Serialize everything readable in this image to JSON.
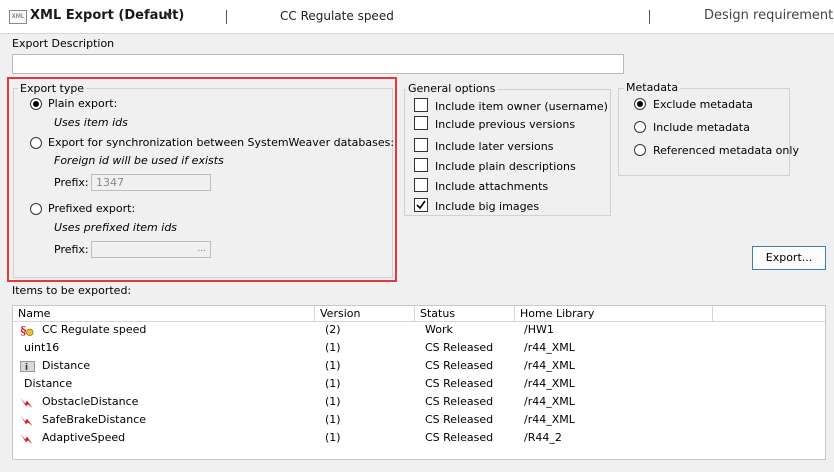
{
  "header": {
    "app_icon_text": "XML",
    "title": "XML Export (Default)",
    "item_name": "CC Regulate speed",
    "item_type": "Design requirement"
  },
  "export_description": {
    "label": "Export Description",
    "value": ""
  },
  "export_type": {
    "legend": "Export type",
    "plain": {
      "label": "Plain export:",
      "hint": "Uses item ids",
      "selected": true
    },
    "sync": {
      "label": "Export for synchronization between SystemWeaver databases:",
      "hint": "Foreign id will be used if exists",
      "prefix_label": "Prefix:",
      "prefix_value": "1347",
      "selected": false
    },
    "prefixed": {
      "label": "Prefixed export:",
      "hint": "Uses prefixed item ids",
      "prefix_label": "Prefix:",
      "prefix_value": "",
      "browse": "...",
      "selected": false
    }
  },
  "general_options": {
    "legend": "General options",
    "items": [
      {
        "label": "Include item owner (username)",
        "checked": false
      },
      {
        "label": "Include previous versions",
        "checked": false
      },
      {
        "label": "Include later versions",
        "checked": false
      },
      {
        "label": "Include plain descriptions",
        "checked": false
      },
      {
        "label": "Include attachments",
        "checked": false
      },
      {
        "label": "Include big images",
        "checked": true
      }
    ]
  },
  "metadata": {
    "legend": "Metadata",
    "items": [
      {
        "label": "Exclude metadata",
        "selected": true
      },
      {
        "label": "Include metadata",
        "selected": false
      },
      {
        "label": "Referenced metadata only",
        "selected": false
      }
    ]
  },
  "export_button": "Export...",
  "items_table": {
    "label": "Items to be exported:",
    "columns": [
      "Name",
      "Version",
      "Status",
      "Home Library"
    ],
    "rows": [
      {
        "icon": "requirement-section-icon",
        "name": "CC Regulate speed",
        "version": "(2)",
        "status": "Work",
        "library": "/HW1"
      },
      {
        "icon": "",
        "name": "uint16",
        "version": "(1)",
        "status": "CS Released",
        "library": "/r44_XML"
      },
      {
        "icon": "info-icon",
        "name": "Distance",
        "version": "(1)",
        "status": "CS Released",
        "library": "/r44_XML"
      },
      {
        "icon": "",
        "name": "Distance",
        "version": "(1)",
        "status": "CS Released",
        "library": "/r44_XML"
      },
      {
        "icon": "signal-icon",
        "name": "ObstacleDistance",
        "version": "(1)",
        "status": "CS Released",
        "library": "/r44_XML"
      },
      {
        "icon": "signal-icon",
        "name": "SafeBrakeDistance",
        "version": "(1)",
        "status": "CS Released",
        "library": "/r44_XML"
      },
      {
        "icon": "signal-icon",
        "name": "AdaptiveSpeed",
        "version": "(1)",
        "status": "CS Released",
        "library": "/R44_2"
      }
    ]
  },
  "colors": {
    "accent_frame": "#e0393e",
    "button_border": "#3c7fb1",
    "signal_icon": "#d62020"
  }
}
